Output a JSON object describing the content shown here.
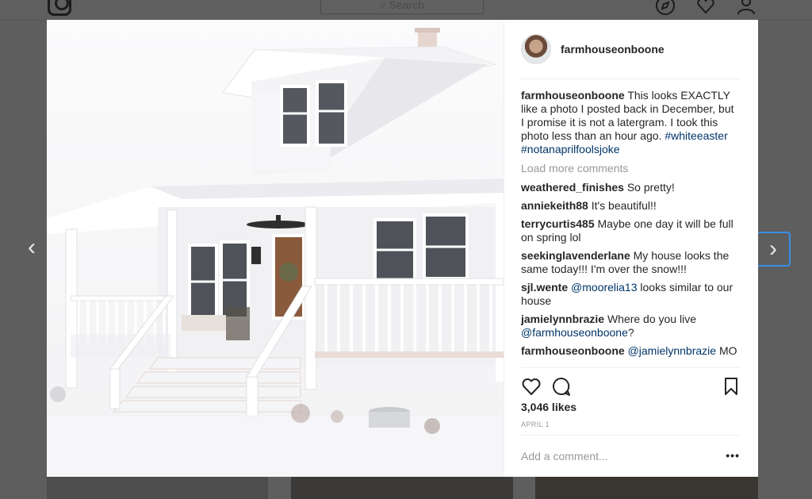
{
  "header": {
    "search_placeholder": "Search"
  },
  "post": {
    "username": "farmhouseonboone",
    "caption": {
      "user": "farmhouseonboone",
      "text": "This looks EXACTLY like a photo I posted back in December, but I promise it is not a latergram. I took this photo less than an hour ago.",
      "hashtags": [
        "#whiteeaster",
        "#notanaprilfoolsjoke"
      ]
    },
    "load_more": "Load more comments",
    "comments": [
      {
        "user": "weathered_finishes",
        "text": "So pretty!"
      },
      {
        "user": "anniekeith88",
        "text": "It's beautiful!!"
      },
      {
        "user": "terrycurtis485",
        "text": "Maybe one day it will be full on spring lol"
      },
      {
        "user": "seekinglavenderlane",
        "text": "My house looks the same today!!! I'm over the snow!!!"
      },
      {
        "user": "sjl.wente",
        "mention": "@moorelia13",
        "text": "looks similar to our house"
      },
      {
        "user": "jamielynnbrazie",
        "text": "Where do you live",
        "mention": "@farmhouseonboone",
        "suffix": "?"
      },
      {
        "user": "farmhouseonboone",
        "mention": "@jamielynnbrazie",
        "text": "MO"
      }
    ],
    "likes": "3,046 likes",
    "date": "APRIL 1",
    "add_comment_placeholder": "Add a comment...",
    "more_label": "•••"
  },
  "nav": {
    "prev": "‹",
    "next": "›"
  },
  "colors": {
    "link": "#003569",
    "muted": "#999999",
    "accent": "#3b8ee8"
  }
}
